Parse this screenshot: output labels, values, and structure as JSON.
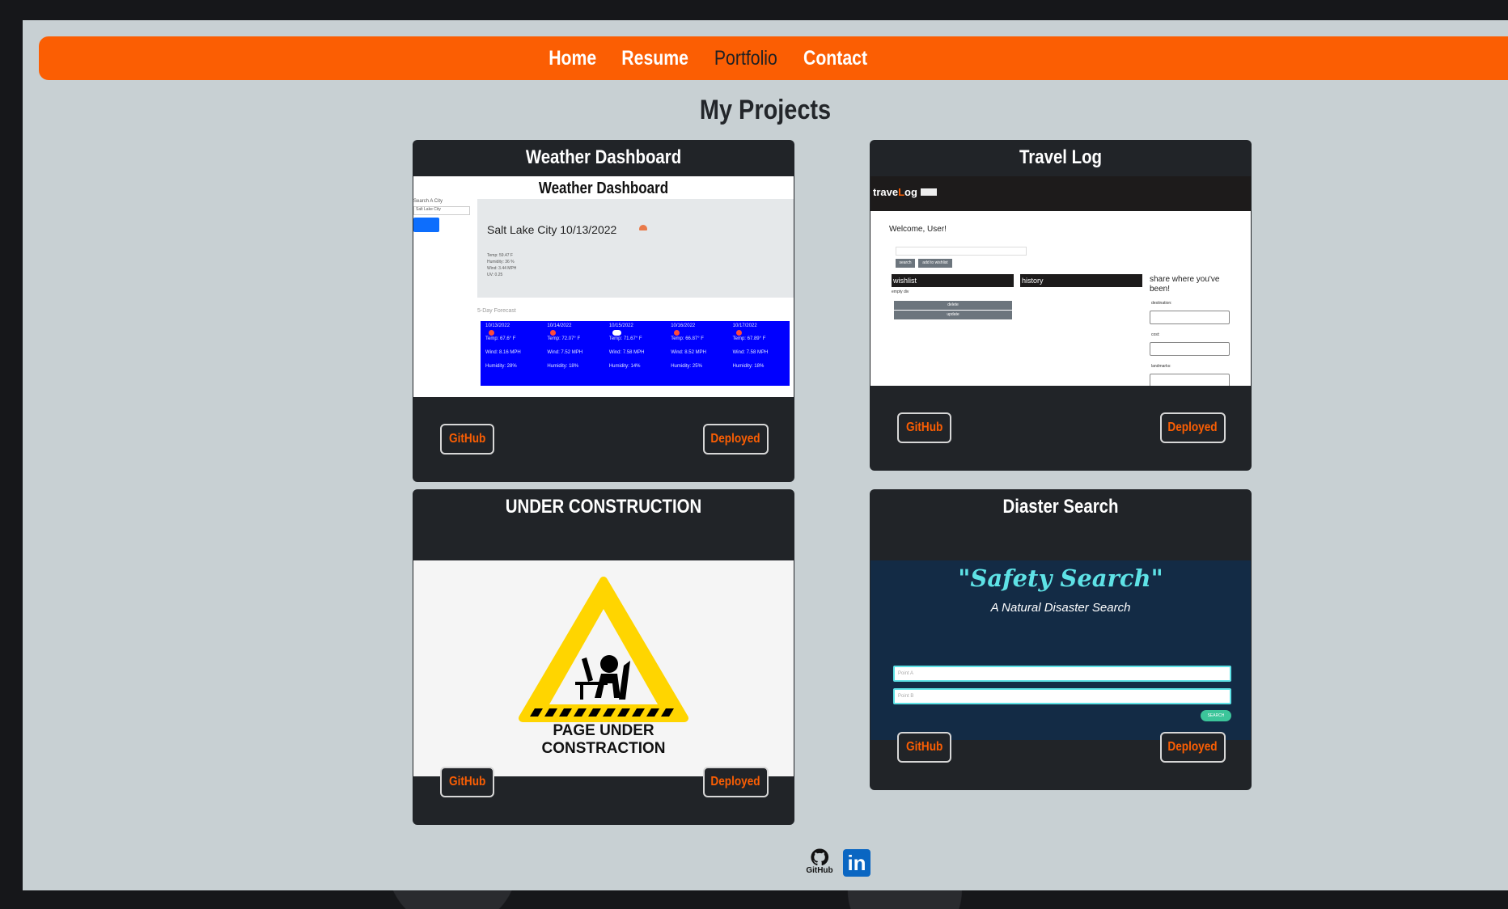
{
  "nav": {
    "items": [
      {
        "label": "Home"
      },
      {
        "label": "Resume"
      },
      {
        "label": "Portfolio"
      },
      {
        "label": "Contact"
      }
    ]
  },
  "page_title": "My Projects",
  "projects": [
    {
      "title": "Weather Dashboard",
      "github_label": "GitHub",
      "deployed_label": "Deployed",
      "preview": {
        "heading": "Weather Dashboard",
        "search_label": "Search A City",
        "search_value": "Salt Lake City",
        "city_date": "Salt Lake City 10/13/2022",
        "details": [
          "Temp: 59.47 F",
          "Humidity: 36 %",
          "Wind: 3.44 MPH",
          "UV: 0.25"
        ],
        "forecast_label": "5-Day Forecast",
        "forecast": [
          {
            "date": "10/13/2022",
            "temp": "Temp: 67.6° F",
            "wind": "Wind: 8.16 MPH",
            "humidity": "Humidity: 28%"
          },
          {
            "date": "10/14/2022",
            "temp": "Temp: 72.07° F",
            "wind": "Wind: 7.52 MPH",
            "humidity": "Humidity: 18%"
          },
          {
            "date": "10/15/2022",
            "temp": "Temp: 71.67° F",
            "wind": "Wind: 7.58 MPH",
            "humidity": "Humidity: 14%"
          },
          {
            "date": "10/16/2022",
            "temp": "Temp: 66.87° F",
            "wind": "Wind: 8.52 MPH",
            "humidity": "Humidity: 25%"
          },
          {
            "date": "10/17/2022",
            "temp": "Temp: 67.89° F",
            "wind": "Wind: 7.58 MPH",
            "humidity": "Humidity: 18%"
          }
        ]
      }
    },
    {
      "title": "Travel Log",
      "github_label": "GitHub",
      "deployed_label": "Deployed",
      "preview": {
        "logo_a": "trave",
        "logo_b": "L",
        "logo_c": "og",
        "welcome": "Welcome, User!",
        "search_btn": "search",
        "wishlist_btn": "add to wishlist",
        "wishlist": "wishlist",
        "history": "history",
        "empty": "empty div",
        "delete": "delete",
        "update": "update",
        "share": "share where you've been!",
        "destination": "destination:",
        "cost": "cost:",
        "landmarks": "landmarks:"
      }
    },
    {
      "title": "UNDER CONSTRUCTION",
      "github_label": "GitHub",
      "deployed_label": "Deployed",
      "preview": {
        "line1": "PAGE UNDER",
        "line2": "CONSTRACTION"
      }
    },
    {
      "title": "Diaster Search",
      "github_label": "GitHub",
      "deployed_label": "Deployed",
      "preview": {
        "title": "\"Safety Search\"",
        "subtitle": "A Natural Disaster Search",
        "point_a": "Point A",
        "point_b": "Point B",
        "search": "SEARCH"
      }
    }
  ],
  "footer": {
    "github_label": "GitHub",
    "linkedin_label": "in"
  },
  "colors": {
    "accent": "#fb5e03",
    "page_bg": "#c8d0d3",
    "card_bg": "#212428"
  }
}
